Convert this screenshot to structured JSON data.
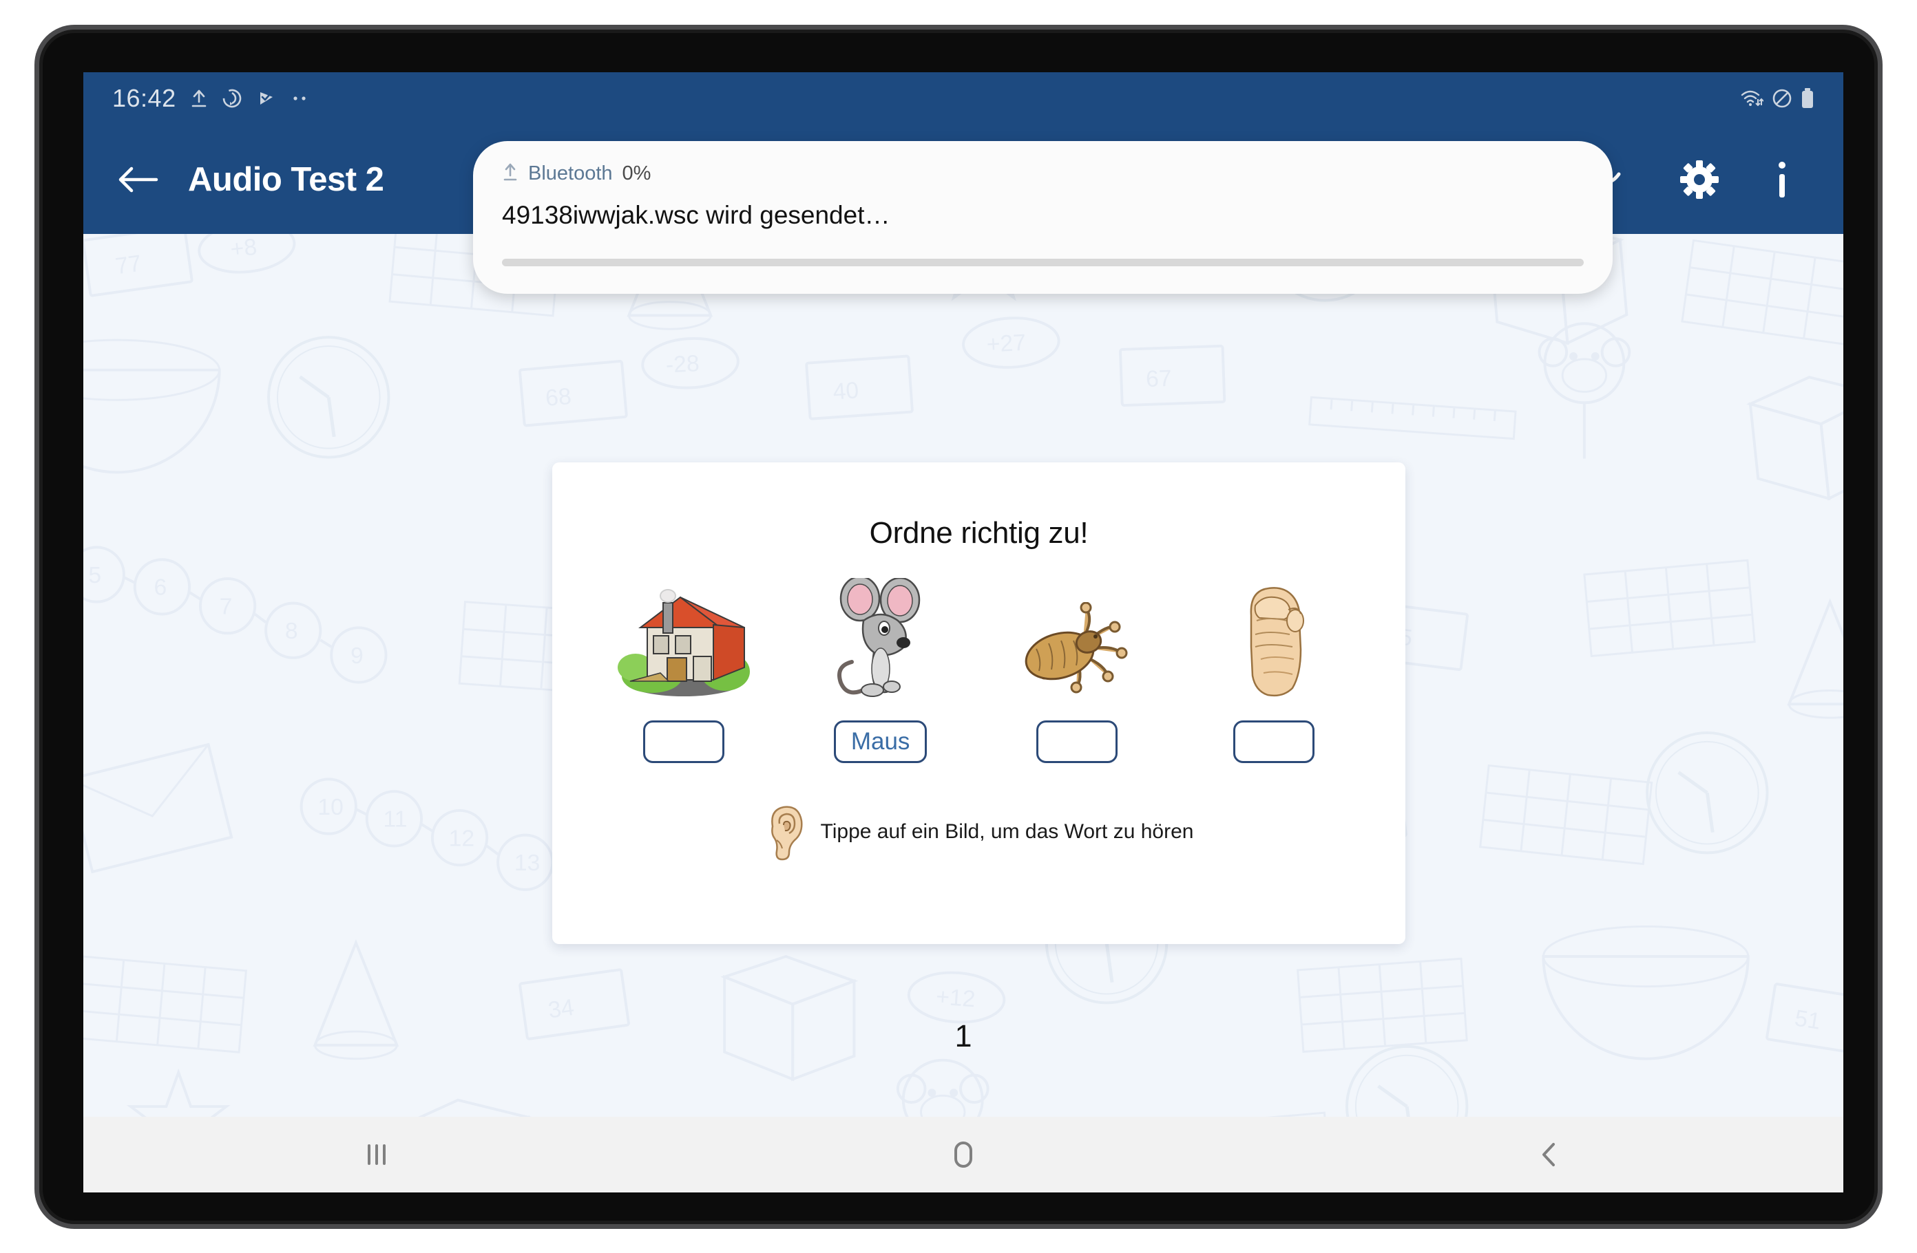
{
  "status_bar": {
    "time": "16:42",
    "left_icons": [
      "upload-icon",
      "sync-icon",
      "check-flag-icon",
      "more-dots-icon"
    ],
    "right_icons": [
      "wifi-icon",
      "do-not-disturb-icon",
      "battery-icon"
    ]
  },
  "app_header": {
    "back_label": "back-arrow",
    "title": "Audio Test 2",
    "actions": [
      "reset-icon",
      "arc-icon",
      "settings-icon",
      "info-icon"
    ],
    "bg_color": "#1d4a80"
  },
  "notification": {
    "app_name": "Bluetooth",
    "percent": "0%",
    "message": "49138iwwjak.wsc wird gesendet…",
    "progress": 0
  },
  "exercise": {
    "title": "Ordne richtig zu!",
    "items": [
      {
        "picture": "house-image",
        "alt": "Haus",
        "answer": ""
      },
      {
        "picture": "mouse-image",
        "alt": "Maus",
        "answer": "Maus"
      },
      {
        "picture": "louse-image",
        "alt": "Laus",
        "answer": ""
      },
      {
        "picture": "fist-image",
        "alt": "Faust",
        "answer": ""
      }
    ],
    "hint": "Tippe auf ein Bild, um das Wort zu hören",
    "hint_icon": "ear-icon",
    "accent_color": "#3a6da6",
    "border_color": "#2c4a78"
  },
  "page_number": "1",
  "nav_bar": {
    "recents_label": "recents-icon",
    "home_label": "home-icon",
    "back_label": "back-icon"
  }
}
